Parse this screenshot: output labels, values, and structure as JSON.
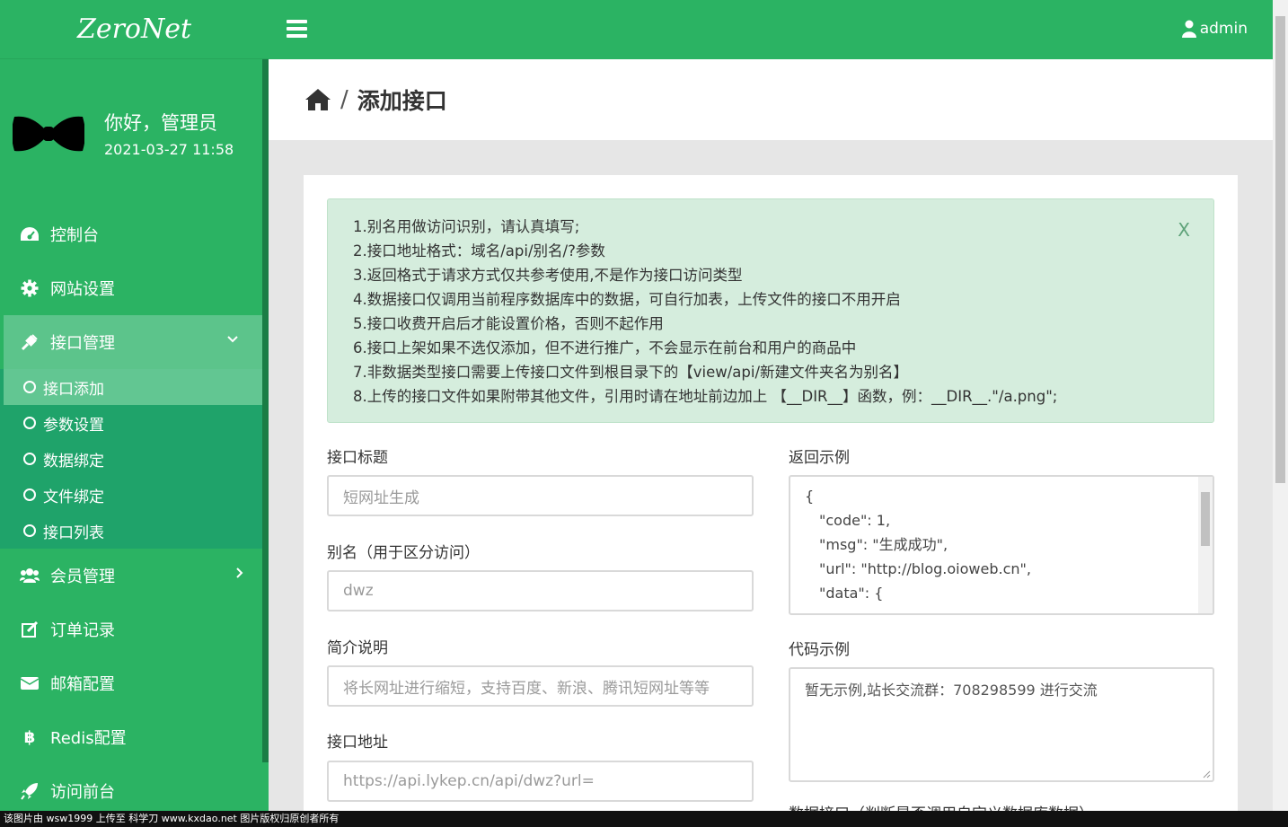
{
  "brand": "ZeroNet",
  "profile": {
    "greeting": "你好，管理员",
    "datetime": "2021-03-27 11:58"
  },
  "nav": [
    {
      "label": "控制台",
      "icon": "dashboard-icon"
    },
    {
      "label": "网站设置",
      "icon": "gear-icon"
    },
    {
      "label": "接口管理",
      "icon": "plug-icon"
    },
    {
      "label": "会员管理",
      "icon": "users-icon"
    },
    {
      "label": "订单记录",
      "icon": "edit-icon"
    },
    {
      "label": "邮箱配置",
      "icon": "mail-icon"
    },
    {
      "label": "Redis配置",
      "icon": "bitcoin-icon"
    },
    {
      "label": "访问前台",
      "icon": "rocket-icon"
    }
  ],
  "subnav": [
    "接口添加",
    "参数设置",
    "数据绑定",
    "文件绑定",
    "接口列表"
  ],
  "topbar": {
    "user": "admin"
  },
  "page": {
    "separator": "/",
    "title": "添加接口"
  },
  "alert": {
    "close": "X",
    "lines": [
      "1.别名用做访问识别，请认真填写;",
      "2.接口地址格式：域名/api/别名/?参数",
      "3.返回格式于请求方式仅共参考使用,不是作为接口访问类型",
      "4.数据接口仅调用当前程序数据库中的数据，可自行加表，上传文件的接口不用开启",
      "5.接口收费开启后才能设置价格，否则不起作用",
      "6.接口上架如果不选仅添加，但不进行推广，不会显示在前台和用户的商品中",
      "7.非数据类型接口需要上传接口文件到根目录下的【view/api/新建文件夹名为别名】",
      "8.上传的接口文件如果附带其他文件，引用时请在地址前边加上 【__DIR__】函数，例：__DIR__.\"/a.png\";"
    ]
  },
  "form": {
    "title_label": "接口标题",
    "title_placeholder": "短网址生成",
    "alias_label": "别名（用于区分访问）",
    "alias_value": "dwz",
    "desc_label": "简介说明",
    "desc_value": "将长网址进行缩短，支持百度、新浪、腾讯短网址等等",
    "url_label": "接口地址",
    "url_value": "https://api.lykep.cn/api/dwz?url=",
    "return_label": "返回示例",
    "return_lines": [
      "{",
      "\"code\": 1,",
      "\"msg\": \"生成成功\",",
      "\"url\": \"http://blog.oioweb.cn\",",
      "\"data\": {"
    ],
    "code_label": "代码示例",
    "code_value": "暂无示例,站长交流群：708298599 进行交流",
    "data_label": "数据接口（判断是否调用自定义数据库数据）"
  },
  "footer": "该图片由 wsw1999 上传至 科学刀 www.kxdao.net 图片版权归原创者所有"
}
